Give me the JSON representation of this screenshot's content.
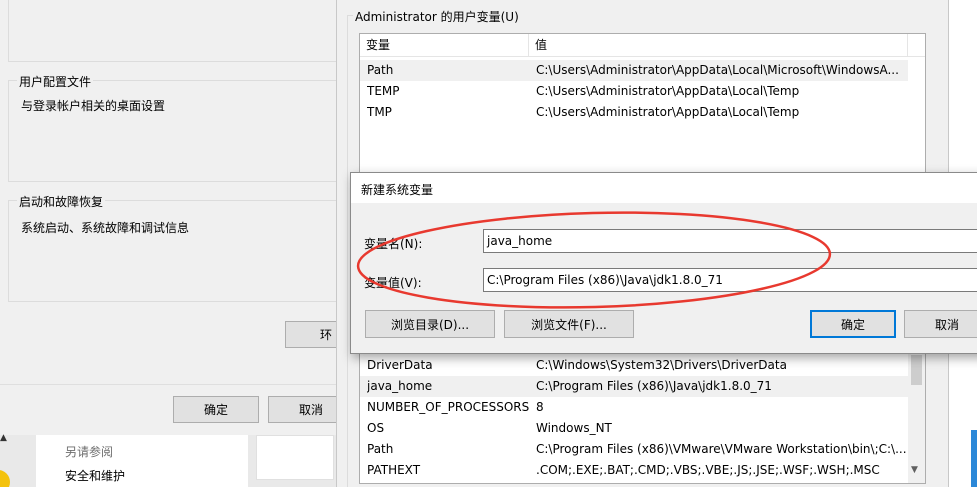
{
  "system_properties": {
    "user_profiles": {
      "title": "用户配置文件",
      "description": "与登录帐户相关的桌面设置"
    },
    "startup_recovery": {
      "title": "启动和故障恢复",
      "description": "系统启动、系统故障和调试信息"
    },
    "env_button_partial": "环",
    "ok_label": "确定",
    "cancel_label": "取消"
  },
  "control_panel": {
    "see_also": "另请参阅",
    "security_item": "安全和维护"
  },
  "env_window": {
    "user_vars_title": "Administrator 的用户变量(U)",
    "columns": {
      "variable": "变量",
      "value": "值"
    },
    "user_vars": [
      {
        "name": "Path",
        "value": "C:\\Users\\Administrator\\AppData\\Local\\Microsoft\\WindowsA..."
      },
      {
        "name": "TEMP",
        "value": "C:\\Users\\Administrator\\AppData\\Local\\Temp"
      },
      {
        "name": "TMP",
        "value": "C:\\Users\\Administrator\\AppData\\Local\\Temp"
      }
    ],
    "system_vars": [
      {
        "name": "DriverData",
        "value": "C:\\Windows\\System32\\Drivers\\DriverData"
      },
      {
        "name": "java_home",
        "value": "C:\\Program Files (x86)\\Java\\jdk1.8.0_71"
      },
      {
        "name": "NUMBER_OF_PROCESSORS",
        "value": "8"
      },
      {
        "name": "OS",
        "value": "Windows_NT"
      },
      {
        "name": "Path",
        "value": "C:\\Program Files (x86)\\VMware\\VMware Workstation\\bin\\;C:\\..."
      },
      {
        "name": "PATHEXT",
        "value": ".COM;.EXE;.BAT;.CMD;.VBS;.VBE;.JS;.JSE;.WSF;.WSH;.MSC"
      }
    ]
  },
  "dialog": {
    "title": "新建系统变量",
    "name_label": "变量名(N):",
    "value_label": "变量值(V):",
    "name_value": "java_home",
    "value_value": "C:\\Program Files (x86)\\Java\\jdk1.8.0_71",
    "browse_dir_label": "浏览目录(D)...",
    "browse_file_label": "浏览文件(F)...",
    "ok_label": "确定",
    "cancel_label": "取消"
  },
  "colors": {
    "annotation_ellipse": "#e8392f",
    "default_button_border": "#0078d7",
    "window_bg": "#f0f0f0"
  }
}
